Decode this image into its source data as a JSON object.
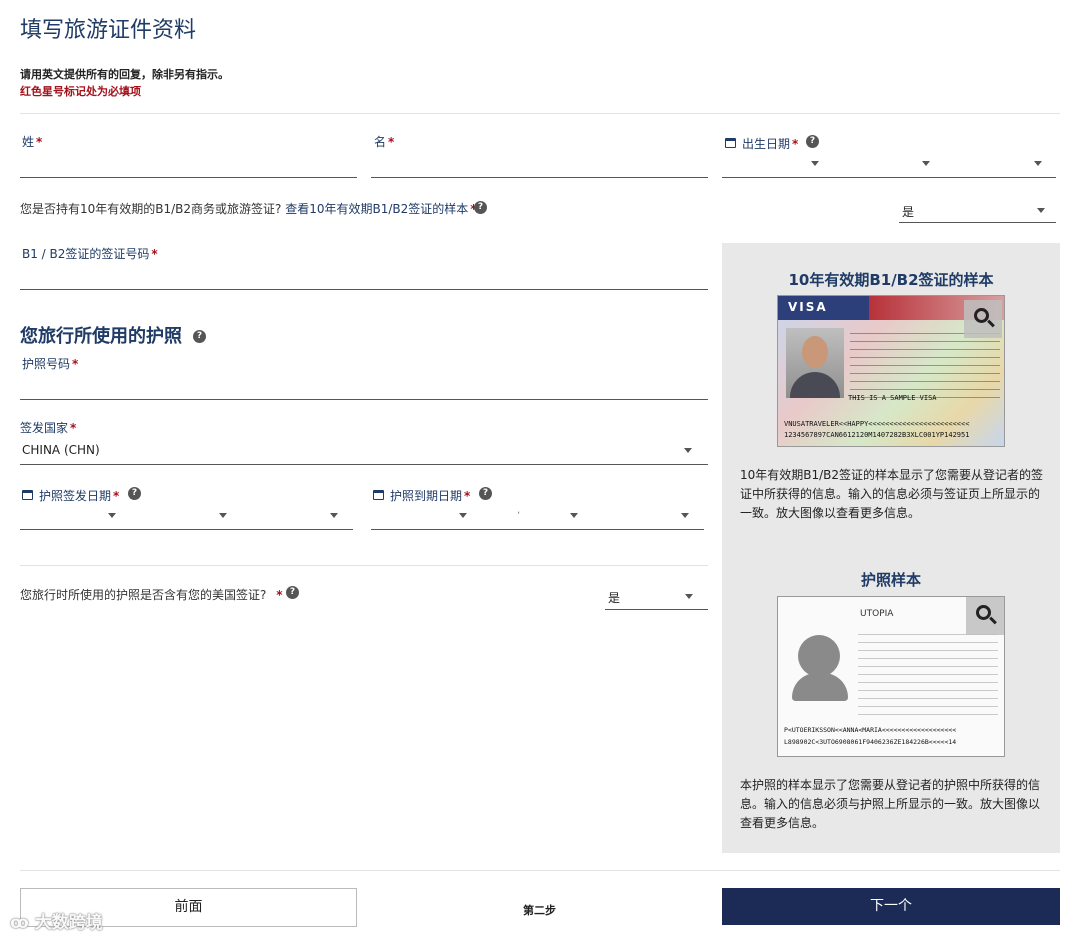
{
  "page": {
    "title": "填写旅游证件资料",
    "instruction": "请用英文提供所有的回复，除非另有指示。",
    "required_note": "红色星号标记处为必填项"
  },
  "fields": {
    "surname": {
      "label": "姓",
      "required": "*",
      "value": ""
    },
    "given_name": {
      "label": "名",
      "required": "*",
      "value": ""
    },
    "birth_date": {
      "label": "出生日期",
      "required": "*"
    },
    "visa_question": {
      "text": "您是否持有10年有效期的B1/B2商务或旅游签证?",
      "link": "查看10年有效期B1/B2签证的样本",
      "required": "*",
      "value": "是"
    },
    "visa_number": {
      "label": "B1 / B2签证的签证号码",
      "required": "*",
      "value": ""
    }
  },
  "passport_section": {
    "title": "您旅行所使用的护照",
    "passport_number": {
      "label": "护照号码",
      "required": "*",
      "value": ""
    },
    "issuing_country": {
      "label": "签发国家",
      "required": "*",
      "value": "CHINA (CHN)"
    },
    "issue_date": {
      "label": "护照签发日期",
      "required": "*"
    },
    "expiry_date": {
      "label": "护照到期日期",
      "required": "*",
      "separator": ","
    },
    "contains_visa": {
      "text": "您旅行时所使用的护照是否含有您的美国签证?",
      "required": "*",
      "value": "是"
    }
  },
  "side_panel": {
    "visa_sample_title": "10年有效期B1/B2签证的样本",
    "visa_image": {
      "header_word": "VISA",
      "sample_text": "THIS IS A SAMPLE VISA",
      "mrz1": "VNUSATRAVELER<<HAPPY<<<<<<<<<<<<<<<<<<<<<<<<",
      "mrz2": "1234567897CAN6612120M1407282B3XLC001YP142951"
    },
    "visa_sample_desc": "10年有效期B1/B2签证的样本显示了您需要从登记者的签证中所获得的信息。输入的信息必须与签证页上所显示的一致。放大图像以查看更多信息。",
    "passport_sample_title": "护照样本",
    "passport_image": {
      "country": "UTOPIA",
      "mrz1": "P<UTOERIKSSON<<ANNA<MARIA<<<<<<<<<<<<<<<<<<<",
      "mrz2": "L898902C<3UTO6908061F9406236ZE184226B<<<<<14"
    },
    "passport_sample_desc": "本护照的样本显示了您需要从登记者的护照中所获得的信息。输入的信息必须与护照上所显示的一致。放大图像以查看更多信息。"
  },
  "footer": {
    "prev_label": "前面",
    "step_label": "第二步",
    "next_label": "下一个"
  },
  "watermark": "大数跨境",
  "icons": {
    "calendar": "calendar-icon",
    "help": "help-icon",
    "dropdown": "chevron-down-icon",
    "zoom": "magnifier-icon"
  },
  "colors": {
    "heading": "#1f3b66",
    "required": "#a3111b",
    "primary_button": "#1c2b55",
    "panel_bg": "#e8e8e8"
  }
}
